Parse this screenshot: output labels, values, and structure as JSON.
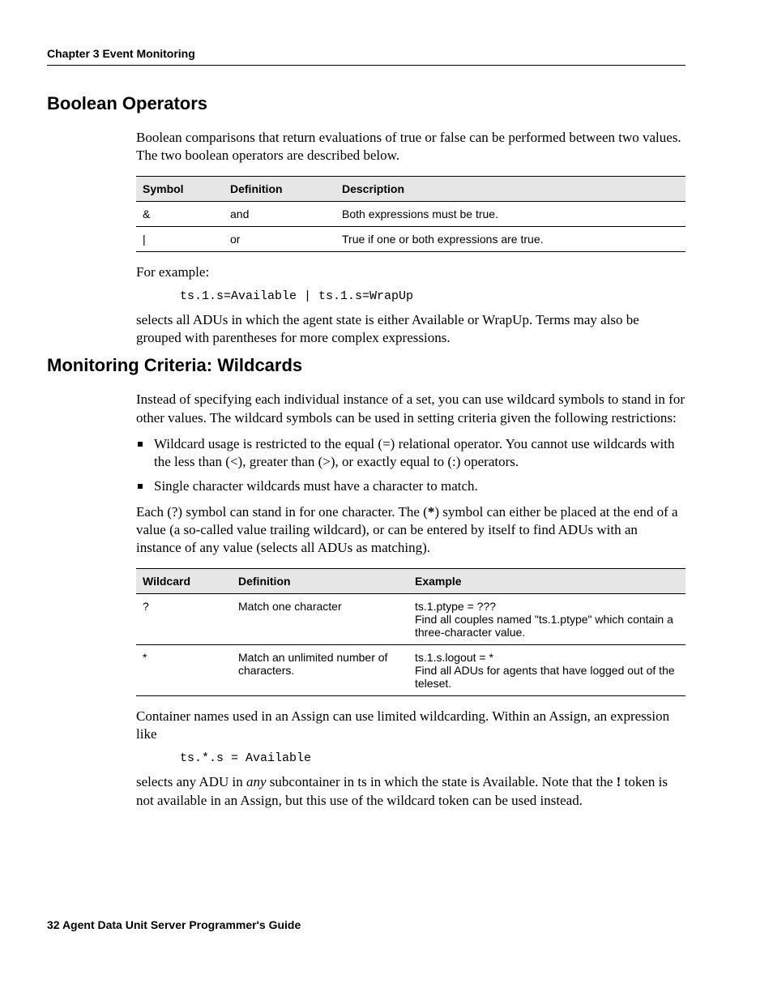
{
  "header": "Chapter 3   Event Monitoring",
  "section1": {
    "title": "Boolean Operators",
    "intro": "Boolean comparisons that return evaluations of true or false can be performed between two values. The two boolean operators are described below.",
    "table_headers": {
      "c1": "Symbol",
      "c2": "Definition",
      "c3": "Description"
    },
    "rows": [
      {
        "c1": "&",
        "c2": "and",
        "c3": "Both expressions must be true."
      },
      {
        "c1": "|",
        "c2": "or",
        "c3": "True if one or both expressions are true."
      }
    ],
    "example_label": "For example:",
    "code": "ts.1.s=Available | ts.1.s=WrapUp",
    "outro": "selects all ADUs in which the agent state is either Available or WrapUp. Terms may also be grouped with parentheses for more complex expressions."
  },
  "section2": {
    "title": "Monitoring Criteria: Wildcards",
    "intro": "Instead of specifying each individual instance of a set, you can use wildcard symbols to stand in for other values. The wildcard symbols can be used in setting criteria given the following restrictions:",
    "bullets": [
      "Wildcard usage is restricted to the equal (=) relational operator. You cannot use wildcards with the less than (<), greater than (>), or exactly equal to (:) operators.",
      "Single character wildcards must have a character to match."
    ],
    "para_pre": "Each (?) symbol can stand in for one character. The (",
    "para_bold": "*",
    "para_post": ") symbol can either be placed at the end of a value (a so-called value trailing wildcard), or can be entered by itself to find ADUs with an instance of any value (selects all ADUs as matching).",
    "table_headers": {
      "c1": "Wildcard",
      "c2": "Definition",
      "c3": "Example"
    },
    "rows": [
      {
        "c1": "?",
        "c2": "Match one character",
        "c3": "ts.1.ptype = ???\nFind all couples named \"ts.1.ptype\" which contain a three-character value."
      },
      {
        "c1": "*",
        "c2": "Match an unlimited number of characters.",
        "c3": "ts.1.s.logout = *\nFind all ADUs for agents that have logged out of the teleset."
      }
    ],
    "outro1": "Container names used in an Assign can use limited wildcarding. Within an Assign, an expression like",
    "code": "ts.*.s = Available",
    "outro2_pre": "selects any ADU in ",
    "outro2_emph": "any",
    "outro2_mid": " subcontainer in ts in which the state is Available. Note that the ",
    "outro2_bold": "!",
    "outro2_post": " token is not available in an Assign, but this use of the wildcard token can be used instead."
  },
  "footer": "32   Agent Data Unit Server Programmer's Guide"
}
